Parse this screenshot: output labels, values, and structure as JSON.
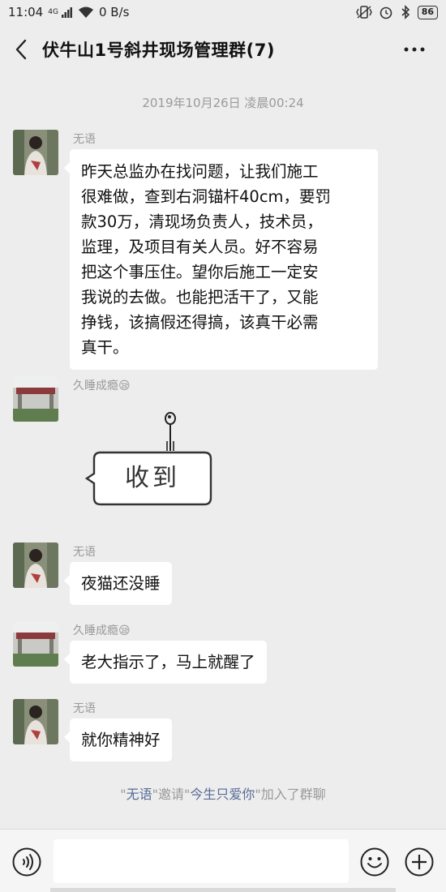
{
  "status_bar": {
    "time": "11:04",
    "network_label": "4G",
    "speed": "0 B/s",
    "battery": "86"
  },
  "header": {
    "title": "伏牛山1号斜井现场管理群(7)",
    "back_icon": "chevron-left-icon",
    "more_icon": "more-dots-icon"
  },
  "chat": {
    "timestamp": "2019年10月26日 凌晨00:24",
    "messages": [
      {
        "sender": "无语",
        "lines": [
          "昨天总监办在找问题，让我们施工",
          "很难做，查到右洞锚杆40cm，要罚",
          "款30万，清现场负责人，技术员，",
          "监理，及项目有关人员。好不容易",
          "把这个事压住。望你后施工一定安",
          "我说的去做。也能把活干了，又能",
          "挣钱，该搞假还得搞，该真干必需",
          "真干。"
        ]
      },
      {
        "sender": "久睡成瘾😪",
        "sticker_text": "收到"
      },
      {
        "sender": "无语",
        "text": "夜猫还没睡"
      },
      {
        "sender": "久睡成瘾😪",
        "text": "老大指示了，马上就醒了"
      },
      {
        "sender": "无语",
        "text": "就你精神好"
      }
    ],
    "system": {
      "q1": "\"",
      "inviter": "无语",
      "q2": "\"邀请\"",
      "invitee": "今生只爱你",
      "q3": "\"加入了群聊"
    }
  },
  "input_bar": {
    "placeholder": "",
    "voice_icon": "voice-icon",
    "emoji_icon": "emoji-icon",
    "plus_icon": "plus-icon"
  }
}
